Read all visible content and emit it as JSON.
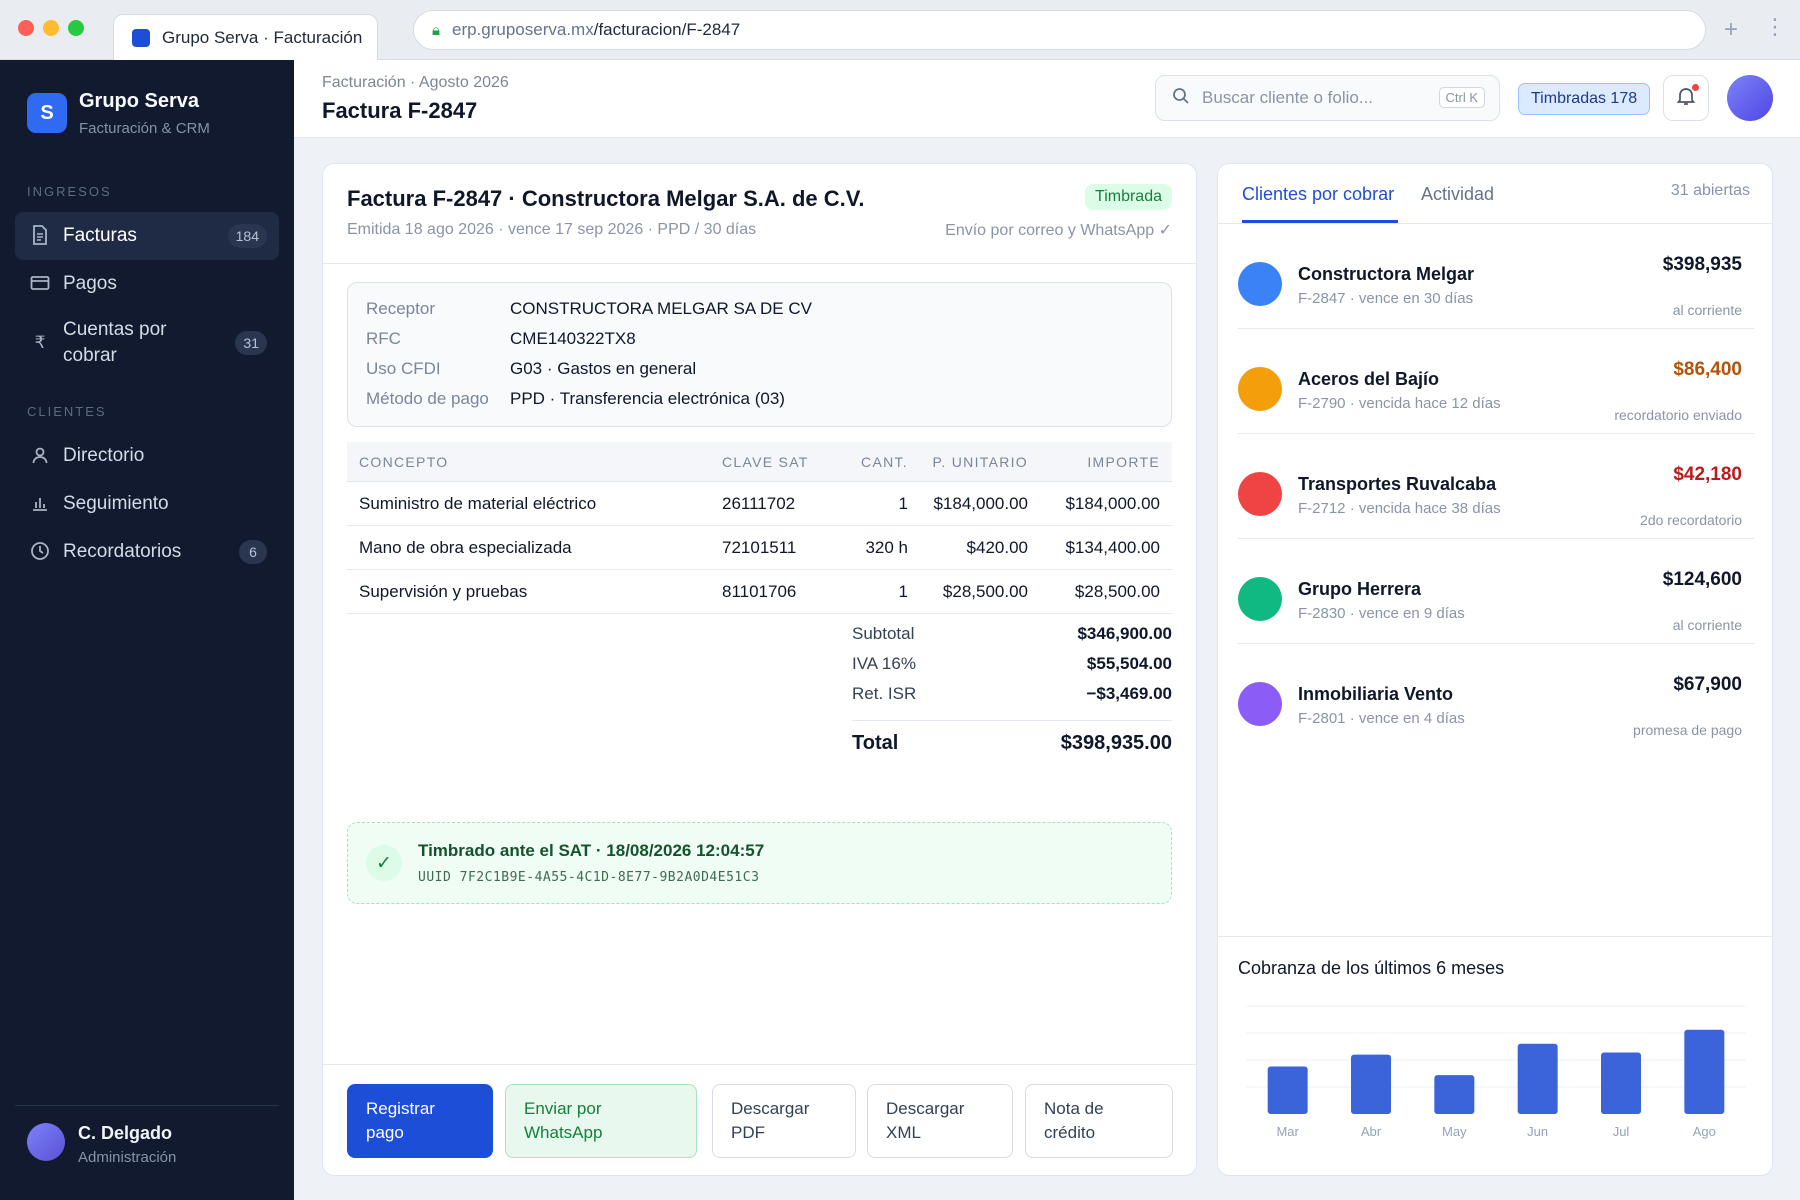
{
  "browser": {
    "tab_title": "Grupo Serva · Facturación",
    "url_host": "erp.gruposerva.mx",
    "url_path": "/facturacion/F-2847"
  },
  "sidebar": {
    "brand_initial": "S",
    "brand_name": "Grupo Serva",
    "brand_sub": "Facturación & CRM",
    "sections": [
      {
        "label": "INGRESOS",
        "items": [
          {
            "label": "Facturas",
            "badge": "184",
            "icon": "document-icon",
            "active": true
          },
          {
            "label": "Pagos",
            "badge": "",
            "icon": "card-icon",
            "active": false
          },
          {
            "label": "Cuentas por cobrar",
            "badge": "31",
            "icon": "currency-icon",
            "active": false
          }
        ]
      },
      {
        "label": "CLIENTES",
        "items": [
          {
            "label": "Directorio",
            "badge": "",
            "icon": "user-icon",
            "active": false
          },
          {
            "label": "Seguimiento",
            "badge": "",
            "icon": "bar-chart-icon",
            "active": false
          },
          {
            "label": "Recordatorios",
            "badge": "6",
            "icon": "clock-icon",
            "active": false
          }
        ]
      }
    ],
    "user": {
      "name": "C. Delgado",
      "role": "Administración"
    }
  },
  "topbar": {
    "breadcrumb": "Facturación · Agosto 2026",
    "title": "Factura F-2847",
    "search_placeholder": "Buscar cliente o folio...",
    "search_shortcut": "Ctrl K",
    "stamped_badge": "Timbradas 178"
  },
  "invoice": {
    "title": "Factura F-2847 · Constructora Melgar S.A. de C.V.",
    "meta": "Emitida 18 ago 2026 · vence 17 sep 2026 · PPD / 30 días",
    "status": "Timbrada",
    "send_note": "Envío por correo y WhatsApp ✓",
    "receptor": [
      {
        "label": "Receptor",
        "value": "CONSTRUCTORA MELGAR SA DE CV"
      },
      {
        "label": "RFC",
        "value": "CME140322TX8"
      },
      {
        "label": "Uso CFDI",
        "value": "G03 · Gastos en general"
      },
      {
        "label": "Método de pago",
        "value": "PPD · Transferencia electrónica (03)"
      }
    ],
    "columns": {
      "concept": "CONCEPTO",
      "clave": "CLAVE SAT",
      "cant": "CANT.",
      "unit": "P. UNITARIO",
      "importe": "IMPORTE"
    },
    "items": [
      {
        "concept": "Suministro de material eléctrico",
        "clave": "26111702",
        "cant": "1",
        "unit": "$184,000.00",
        "importe": "$184,000.00"
      },
      {
        "concept": "Mano de obra especializada",
        "clave": "72101511",
        "cant": "320 h",
        "unit": "$420.00",
        "importe": "$134,400.00"
      },
      {
        "concept": "Supervisión y pruebas",
        "clave": "81101706",
        "cant": "1",
        "unit": "$28,500.00",
        "importe": "$28,500.00"
      }
    ],
    "totals": {
      "subtotal_label": "Subtotal",
      "subtotal": "$346,900.00",
      "iva_label": "IVA 16%",
      "iva": "$55,504.00",
      "ret_label": "Ret. ISR",
      "ret": "−$3,469.00",
      "total_label": "Total",
      "total": "$398,935.00"
    },
    "sat": {
      "title": "Timbrado ante el SAT · 18/08/2026 12:04:57",
      "uuid": "UUID 7F2C1B9E-4A55-4C1D-8E77-9B2A0D4E51C3"
    },
    "actions": {
      "register_payment": "Registrar pago",
      "send_whatsapp": "Enviar por WhatsApp",
      "download_pdf": "Descargar PDF",
      "download_xml": "Descargar XML",
      "credit_note": "Nota de crédito"
    }
  },
  "receivables": {
    "tab_active": "Clientes por cobrar",
    "tab_other": "Actividad",
    "count": "31 abiertas",
    "clients": [
      {
        "name": "Constructora Melgar",
        "detail": "F-2847 · vence en 30 días",
        "amount": "$398,935",
        "status": "al corriente",
        "amount_color": "#0f172a",
        "avatar_color": "#3b82f6"
      },
      {
        "name": "Aceros del Bajío",
        "detail": "F-2790 · vencida hace 12 días",
        "amount": "$86,400",
        "status": "recordatorio enviado",
        "amount_color": "#b45309",
        "avatar_color": "#f59e0b"
      },
      {
        "name": "Transportes Ruvalcaba",
        "detail": "F-2712 · vencida hace 38 días",
        "amount": "$42,180",
        "status": "2do recordatorio",
        "amount_color": "#b91c1c",
        "avatar_color": "#ef4444"
      },
      {
        "name": "Grupo Herrera",
        "detail": "F-2830 · vence en 9 días",
        "amount": "$124,600",
        "status": "al corriente",
        "amount_color": "#0f172a",
        "avatar_color": "#10b981"
      },
      {
        "name": "Inmobiliaria Vento",
        "detail": "F-2801 · vence en 4 días",
        "amount": "$67,900",
        "status": "promesa de pago",
        "amount_color": "#0f172a",
        "avatar_color": "#8b5cf6"
      }
    ],
    "chart_title": "Cobranza de los últimos 6 meses"
  },
  "chart_data": {
    "type": "bar",
    "categories": [
      "Mar",
      "Abr",
      "May",
      "Jun",
      "Jul",
      "Ago"
    ],
    "values": [
      44,
      55,
      36,
      65,
      57,
      78
    ],
    "ylim": [
      0,
      100
    ],
    "color": "#3b64db",
    "grid": true
  }
}
